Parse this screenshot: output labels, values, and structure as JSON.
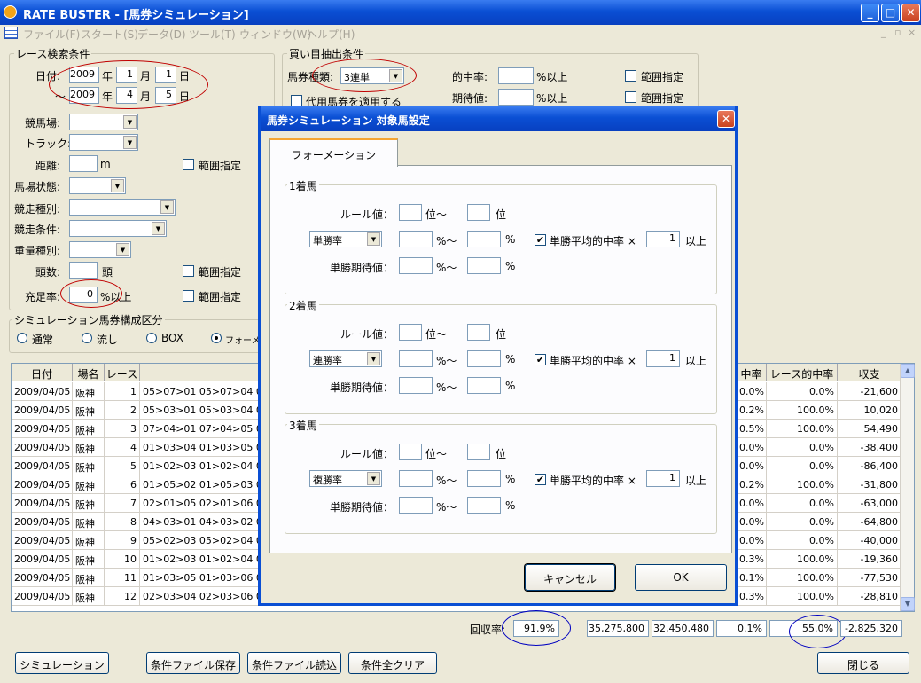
{
  "window": {
    "title": "RATE BUSTER - [馬券シミュレーション]",
    "min": "_",
    "max": "□",
    "close": "✕"
  },
  "menu": {
    "items": [
      "ファイル(F)",
      "スタート(S)",
      "データ(D)",
      "ツール(T)",
      "ウィンドウ(W)",
      "ヘルプ(H)"
    ],
    "mdi": [
      "_",
      "▫",
      "×"
    ]
  },
  "race_search": {
    "group_title": "レース検索条件",
    "date_label": "日付:",
    "from": {
      "year": "2009",
      "month": "1",
      "day": "1"
    },
    "to": {
      "year": "2009",
      "month": "4",
      "day": "5"
    },
    "year_unit": "年",
    "month_unit": "月",
    "day_unit": "日",
    "tilde": "～",
    "venue_label": "競馬場:",
    "track_label": "トラック:",
    "distance_label": "距離:",
    "distance_unit": "m",
    "condition_label": "馬場状態:",
    "race_type_label": "競走種別:",
    "race_cond_label": "競走条件:",
    "weight_label": "重量種別:",
    "heads_label": "頭数:",
    "heads_unit": "頭",
    "fill_label": "充足率:",
    "fill_value": "0",
    "fill_unit": "%以上",
    "range_label": "範囲指定"
  },
  "bet_extract": {
    "group_title": "買い目抽出条件",
    "ticket_label": "馬券種類:",
    "ticket_value": "3連単",
    "substitute_label": "代用馬券を適用する",
    "hit_label": "的中率:",
    "ev_label": "期待値:",
    "unit": "%以上",
    "range_label": "範囲指定"
  },
  "sim_comp": {
    "group_title": "シミュレーション馬券構成区分",
    "options": [
      "通常",
      "流し",
      "BOX",
      "フォーメー"
    ],
    "selected": 3
  },
  "table": {
    "headers": [
      "日付",
      "場名",
      "レース",
      "",
      "中率",
      "レース的中率",
      "収支"
    ],
    "rows": [
      [
        "2009/04/05",
        "阪神",
        "1",
        "05>07>01 05>07>04 05>07",
        "0.0%",
        "0.0%",
        "-21,600"
      ],
      [
        "2009/04/05",
        "阪神",
        "2",
        "05>03>01 05>03>04 05>03",
        "0.2%",
        "100.0%",
        "10,020"
      ],
      [
        "2009/04/05",
        "阪神",
        "3",
        "07>04>01 07>04>05 07>04",
        "0.5%",
        "100.0%",
        "54,490"
      ],
      [
        "2009/04/05",
        "阪神",
        "4",
        "01>03>04 01>03>05 01>0",
        "0.0%",
        "0.0%",
        "-38,400"
      ],
      [
        "2009/04/05",
        "阪神",
        "5",
        "01>02>03 01>02>04 01>02",
        "0.0%",
        "0.0%",
        "-86,400"
      ],
      [
        "2009/04/05",
        "阪神",
        "6",
        "01>05>02 01>05>03 01>05",
        "0.2%",
        "100.0%",
        "-31,800"
      ],
      [
        "2009/04/05",
        "阪神",
        "7",
        "02>01>05 02>01>06 02>01",
        "0.0%",
        "0.0%",
        "-63,000"
      ],
      [
        "2009/04/05",
        "阪神",
        "8",
        "04>03>01 04>03>02 04>03",
        "0.0%",
        "0.0%",
        "-64,800"
      ],
      [
        "2009/04/05",
        "阪神",
        "9",
        "05>02>03 05>02>04 05>02",
        "0.0%",
        "0.0%",
        "-40,000"
      ],
      [
        "2009/04/05",
        "阪神",
        "10",
        "01>02>03 01>02>04 01>02",
        "0.3%",
        "100.0%",
        "-19,360"
      ],
      [
        "2009/04/05",
        "阪神",
        "11",
        "01>03>05 01>03>06 01>03",
        "0.1%",
        "100.0%",
        "-77,530"
      ],
      [
        "2009/04/05",
        "阪神",
        "12",
        "02>03>04 02>03>06 02>03",
        "0.3%",
        "100.0%",
        "-28,810"
      ]
    ]
  },
  "summary": {
    "recovery_label": "回収率:",
    "recovery": "91.9%",
    "spent": "35,275,800",
    "returned": "32,450,480",
    "hit": "0.1%",
    "race_hit": "55.0%",
    "balance": "-2,825,320"
  },
  "bottom_buttons": {
    "simulate": "シミュレーション",
    "save": "条件ファイル保存",
    "load": "条件ファイル読込",
    "clear": "条件全クリア",
    "close": "閉じる"
  },
  "dialog": {
    "title": "馬券シミュレーション 対象馬設定",
    "close": "✕",
    "tab": "フォーメーション",
    "sections": [
      {
        "title": "1着馬",
        "rule_label": "ルール値：",
        "rank_from": "位～",
        "rank_to": "位",
        "rate_combo": "単勝率",
        "pct1": "%～",
        "pct2": "%",
        "avg_label": "単勝平均的中率 ×",
        "avg_value": "1",
        "avg_unit": "以上",
        "ev_label": "単勝期待値：",
        "ev_pct1": "%～",
        "ev_pct2": "%"
      },
      {
        "title": "2着馬",
        "rule_label": "ルール値：",
        "rank_from": "位～",
        "rank_to": "位",
        "rate_combo": "連勝率",
        "pct1": "%～",
        "pct2": "%",
        "avg_label": "単勝平均的中率 ×",
        "avg_value": "1",
        "avg_unit": "以上",
        "ev_label": "単勝期待値：",
        "ev_pct1": "%～",
        "ev_pct2": "%"
      },
      {
        "title": "3着馬",
        "rule_label": "ルール値：",
        "rank_from": "位～",
        "rank_to": "位",
        "rate_combo": "複勝率",
        "pct1": "%～",
        "pct2": "%",
        "avg_label": "単勝平均的中率 ×",
        "avg_value": "1",
        "avg_unit": "以上",
        "ev_label": "単勝期待値：",
        "ev_pct1": "%～",
        "ev_pct2": "%"
      }
    ],
    "cancel": "キャンセル",
    "ok": "OK"
  },
  "colors": {
    "title_blue": "#0a4fd4",
    "annotation_red": "#c00000",
    "annotation_blue": "#0000c0"
  }
}
